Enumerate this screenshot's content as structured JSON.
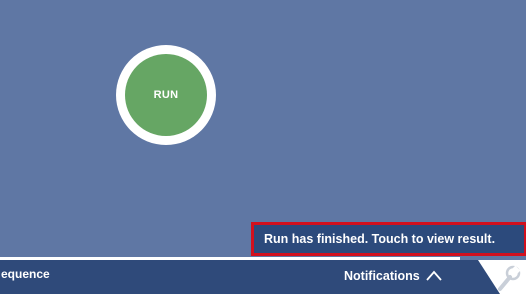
{
  "run_button": {
    "label": "RUN"
  },
  "toast": {
    "text": "Run has finished. Touch to view result."
  },
  "bottom_bar": {
    "sequence_label": "equence",
    "notifications_label": "Notifications",
    "settings_icon": "wrench-icon",
    "notifications_icon": "chevron-up-icon"
  },
  "colors": {
    "background": "#5f77a4",
    "run_fill": "#66a664",
    "toast_bg": "#2c4a7c",
    "toast_border": "#d2101e",
    "bar_bg": "#2f4a7a"
  }
}
